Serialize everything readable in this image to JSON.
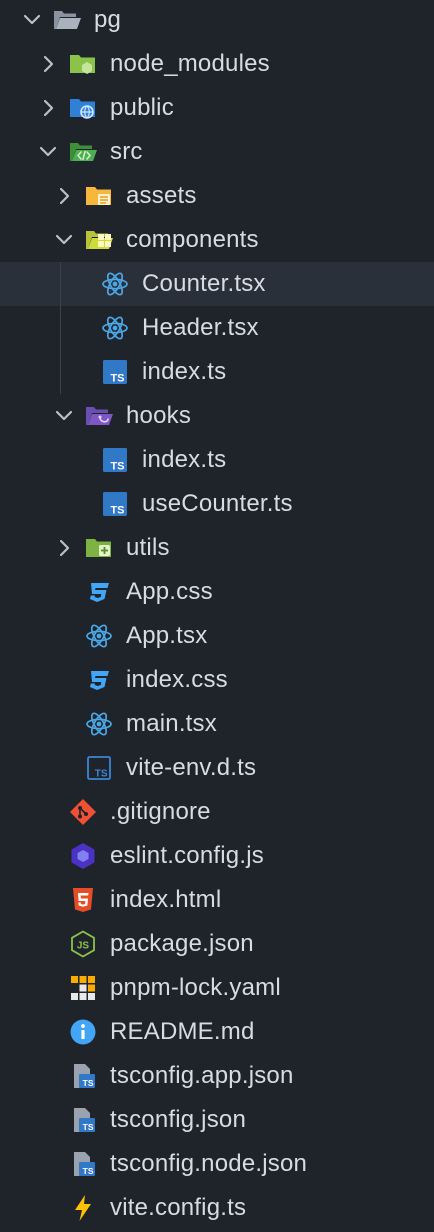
{
  "explorer": {
    "items": [
      {
        "label": "pg",
        "depth": 0,
        "chevron": "open",
        "icon": "folder-open-icon"
      },
      {
        "label": "node_modules",
        "depth": 1,
        "chevron": "closed",
        "icon": "folder-node-icon"
      },
      {
        "label": "public",
        "depth": 1,
        "chevron": "closed",
        "icon": "folder-public-icon"
      },
      {
        "label": "src",
        "depth": 1,
        "chevron": "open",
        "icon": "folder-src-icon"
      },
      {
        "label": "assets",
        "depth": 2,
        "chevron": "closed",
        "icon": "folder-assets-icon"
      },
      {
        "label": "components",
        "depth": 2,
        "chevron": "open",
        "icon": "folder-components-icon"
      },
      {
        "label": "Counter.tsx",
        "depth": 3,
        "chevron": "none",
        "icon": "react-icon",
        "selected": true
      },
      {
        "label": "Header.tsx",
        "depth": 3,
        "chevron": "none",
        "icon": "react-icon"
      },
      {
        "label": "index.ts",
        "depth": 3,
        "chevron": "none",
        "icon": "typescript-icon"
      },
      {
        "label": "hooks",
        "depth": 2,
        "chevron": "open",
        "icon": "folder-hooks-icon"
      },
      {
        "label": "index.ts",
        "depth": 3,
        "chevron": "none",
        "icon": "typescript-icon"
      },
      {
        "label": "useCounter.ts",
        "depth": 3,
        "chevron": "none",
        "icon": "typescript-icon"
      },
      {
        "label": "utils",
        "depth": 2,
        "chevron": "closed",
        "icon": "folder-utils-icon"
      },
      {
        "label": "App.css",
        "depth": 2,
        "chevron": "none",
        "icon": "css-icon"
      },
      {
        "label": "App.tsx",
        "depth": 2,
        "chevron": "none",
        "icon": "react-icon"
      },
      {
        "label": "index.css",
        "depth": 2,
        "chevron": "none",
        "icon": "css-icon"
      },
      {
        "label": "main.tsx",
        "depth": 2,
        "chevron": "none",
        "icon": "react-icon"
      },
      {
        "label": "vite-env.d.ts",
        "depth": 2,
        "chevron": "none",
        "icon": "typescript-def-icon"
      },
      {
        "label": ".gitignore",
        "depth": 1,
        "chevron": "none",
        "icon": "git-icon"
      },
      {
        "label": "eslint.config.js",
        "depth": 1,
        "chevron": "none",
        "icon": "eslint-icon"
      },
      {
        "label": "index.html",
        "depth": 1,
        "chevron": "none",
        "icon": "html5-icon"
      },
      {
        "label": "package.json",
        "depth": 1,
        "chevron": "none",
        "icon": "nodejs-icon"
      },
      {
        "label": "pnpm-lock.yaml",
        "depth": 1,
        "chevron": "none",
        "icon": "pnpm-icon"
      },
      {
        "label": "README.md",
        "depth": 1,
        "chevron": "none",
        "icon": "info-icon"
      },
      {
        "label": "tsconfig.app.json",
        "depth": 1,
        "chevron": "none",
        "icon": "tsconfig-icon"
      },
      {
        "label": "tsconfig.json",
        "depth": 1,
        "chevron": "none",
        "icon": "tsconfig-icon"
      },
      {
        "label": "tsconfig.node.json",
        "depth": 1,
        "chevron": "none",
        "icon": "tsconfig-icon"
      },
      {
        "label": "vite.config.ts",
        "depth": 1,
        "chevron": "none",
        "icon": "vite-icon"
      }
    ]
  },
  "colors": {
    "background": "#1f232a",
    "selected_row": "#2a3039",
    "text": "#d7dce3",
    "chevron": "#b9c0ca",
    "react": "#4aa8e8",
    "typescript": "#3178c6",
    "css": "#42a5f5",
    "git": "#f05033",
    "eslint": "#4b32c3",
    "html": "#e44d26",
    "node": "#8bc34a",
    "vite": "#ffc107",
    "info": "#42a5f5"
  }
}
